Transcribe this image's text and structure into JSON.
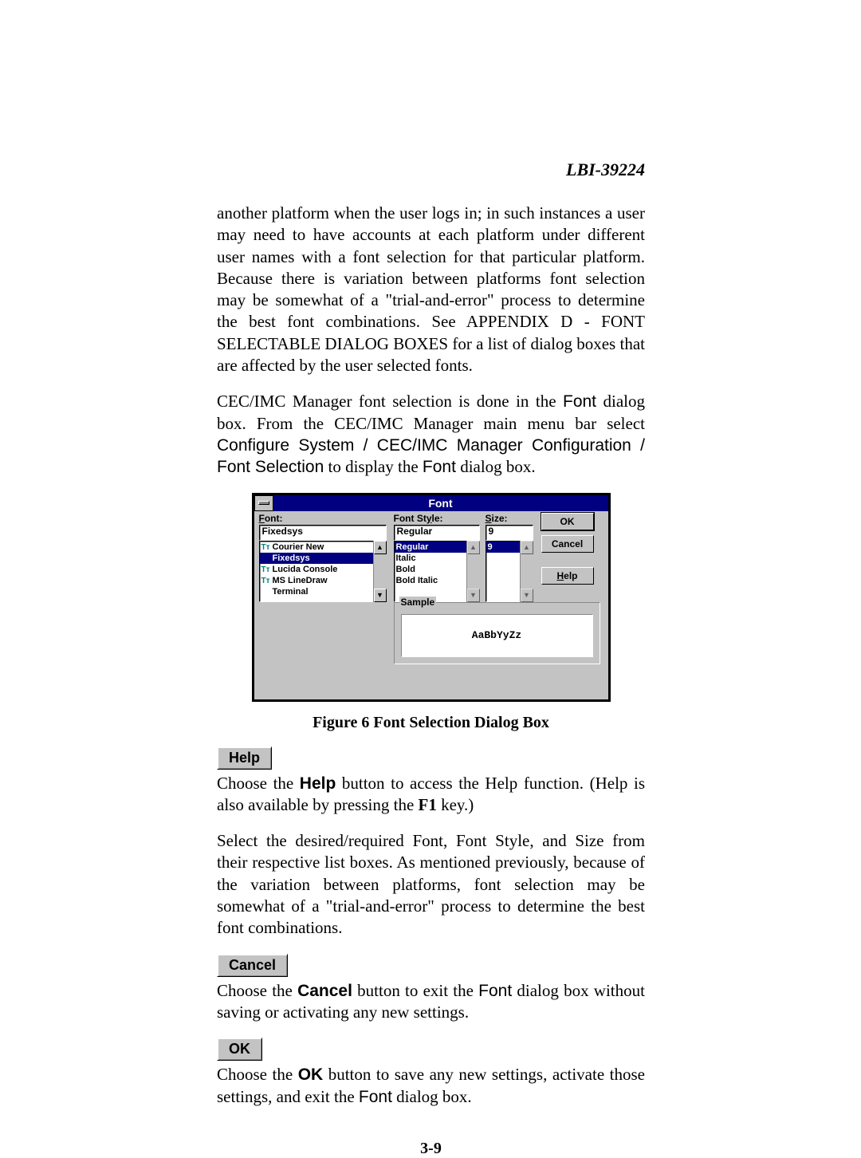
{
  "doc_id": "LBI-39224",
  "para1": "another platform when the user logs in; in such instances a user may need to have accounts at each platform under different user names with a font selection for that particular platform.  Because there is variation between platforms font selection may be somewhat of a \"trial-and-error\" process to determine the best font combinations.    See APPENDIX D - FONT SELECTABLE DIALOG BOXES for a list of dialog boxes that are affected by the user selected fonts.",
  "para2_a": "CEC/IMC Manager font selection is done in the ",
  "para2_b": " dialog box.  From the CEC/IMC Manager main menu bar select ",
  "para2_c": " to display the ",
  "para2_d": " dialog box.",
  "menu_path": "Configure System / CEC/IMC Manager Configuration / Font Selection",
  "font_word": "Font",
  "fig_caption": "Figure 6  Font Selection Dialog Box",
  "help_btn": "Help",
  "para3_a": "Choose the ",
  "para3_b": " button to access the Help function. (Help is also available by pressing the ",
  "para3_c": " key.)",
  "f1": "F1",
  "bold_help": "Help",
  "para4": "Select the desired/required Font, Font Style, and Size from their respective list boxes.  As mentioned previously, because of the variation between platforms, font selection may be somewhat of a \"trial-and-error\" process to determine the best font combinations.",
  "cancel_btn": "Cancel",
  "para5_a": "Choose the ",
  "para5_b": " button to exit the ",
  "para5_c": " dialog box without saving or activating any new settings.",
  "bold_cancel": "Cancel",
  "ok_btn": "OK",
  "para6_a": "Choose the ",
  "para6_b": " button to save any new settings, activate those settings, and exit the ",
  "para6_c": " dialog box.",
  "bold_ok": "OK",
  "page_num": "3-9",
  "dialog": {
    "title": "Font",
    "font_label": "Font:",
    "font_value": "Fixedsys",
    "font_items": [
      "Courier New",
      "Fixedsys",
      "Lucida Console",
      "MS LineDraw",
      "Terminal"
    ],
    "font_sel_index": 1,
    "font_tt_flags": [
      true,
      false,
      true,
      true,
      false
    ],
    "style_label": "Font Style:",
    "style_value": "Regular",
    "style_items": [
      "Regular",
      "Italic",
      "Bold",
      "Bold Italic"
    ],
    "style_sel_index": 0,
    "size_label": "Size:",
    "size_value": "9",
    "size_items": [
      "9"
    ],
    "size_sel_index": 0,
    "ok": "OK",
    "cancel": "Cancel",
    "help": "Help",
    "sample_label": "Sample",
    "sample_text": "AaBbYyZz"
  }
}
